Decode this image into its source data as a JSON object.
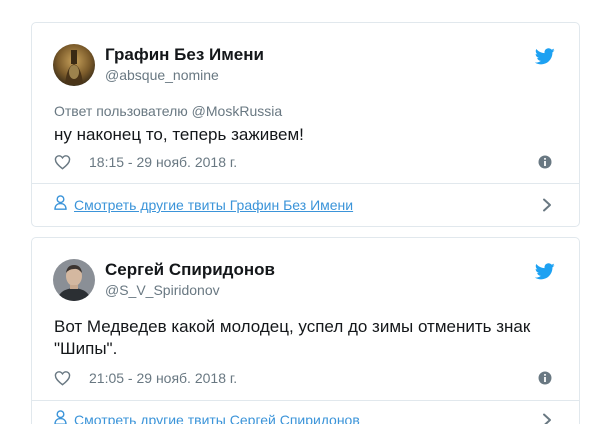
{
  "colors": {
    "text_primary": "#14171a",
    "text_secondary": "#697882",
    "link": "#3b94d9",
    "twitter_blue": "#1da1f2",
    "border": "#e1e8ed"
  },
  "tweets": [
    {
      "author_name": "Графин Без Имени",
      "author_handle": "@absque_nomine",
      "reply_to": "Ответ пользователю @MoskRussia",
      "text_lines": [
        "ну наконец то, теперь заживем!"
      ],
      "timestamp": "18:15 - 29 нояб. 2018 г.",
      "more_link": "Смотреть другие твиты Графин Без Имени",
      "icons": [
        "avatar-image",
        "twitter-bird-icon",
        "heart-icon",
        "info-icon",
        "person-icon",
        "chevron-right-icon"
      ]
    },
    {
      "author_name": "Сергей Спиридонов",
      "author_handle": "@S_V_Spiridonov",
      "text_lines": [
        "Вот Медведев какой молодец, успел до зимы отменить знак",
        "\"Шипы\"."
      ],
      "timestamp": "21:05 - 29 нояб. 2018 г.",
      "more_link": "Смотреть другие твиты Сергей Спиридонов",
      "icons": [
        "avatar-image",
        "twitter-bird-icon",
        "heart-icon",
        "info-icon",
        "person-icon",
        "chevron-right-icon"
      ]
    }
  ]
}
